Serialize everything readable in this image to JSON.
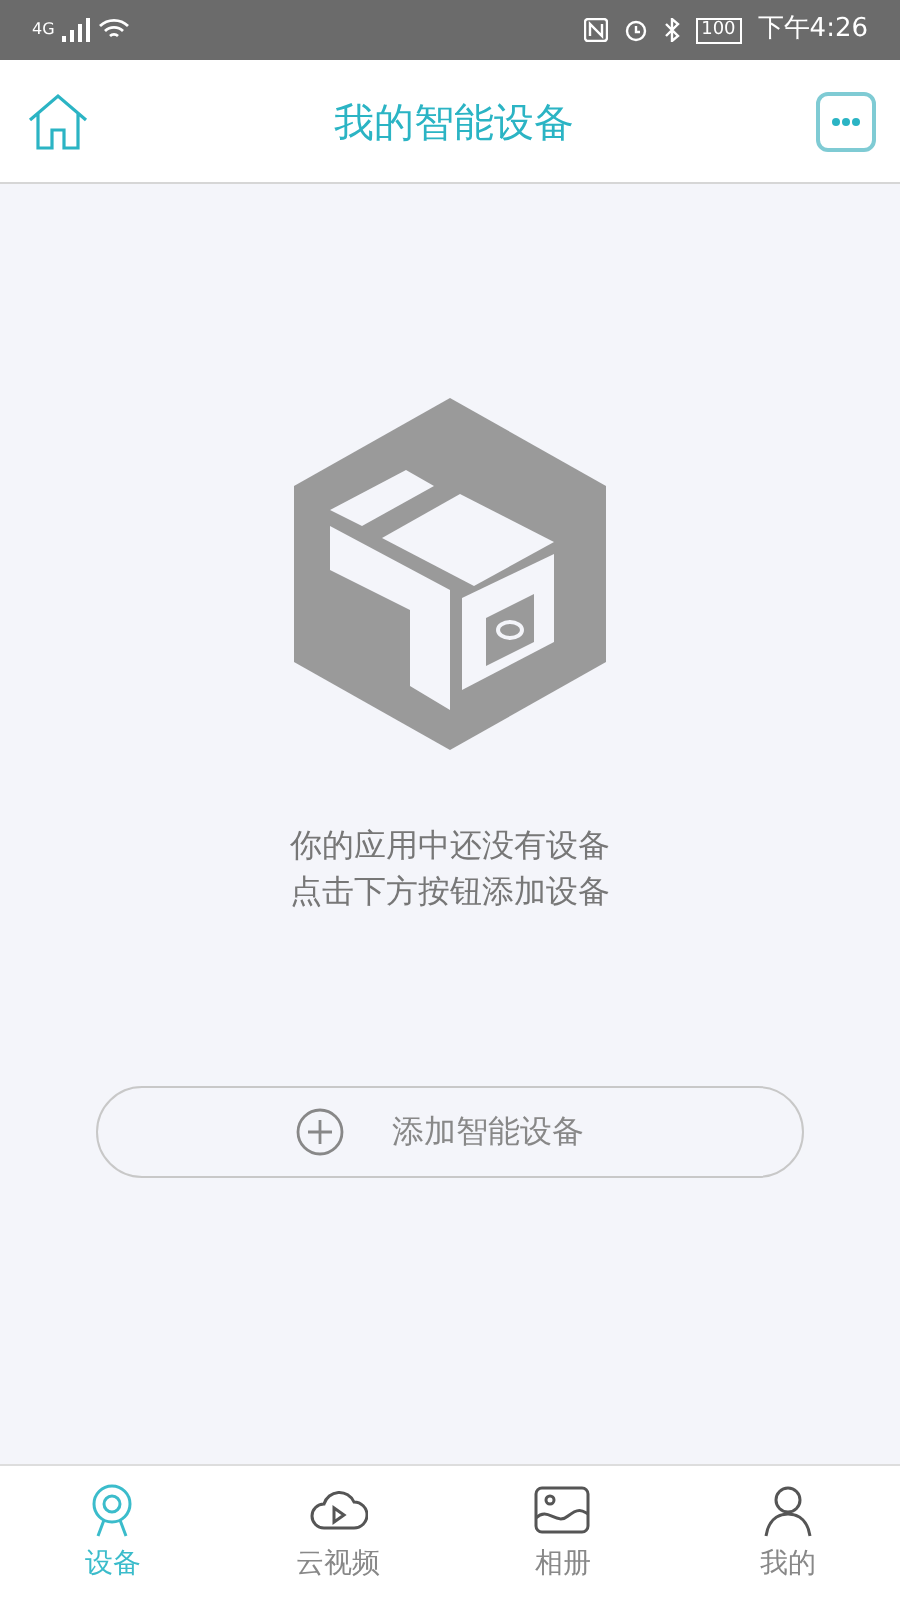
{
  "status_bar": {
    "network": "4G",
    "battery": "100",
    "time": "下午4:26"
  },
  "header": {
    "title": "我的智能设备"
  },
  "empty_state": {
    "lines": [
      "你的应用中还没有设备",
      "点击下方按钮添加设备"
    ]
  },
  "add_button": {
    "label": "添加智能设备"
  },
  "tabs": [
    {
      "kind": "camera",
      "label": "设备",
      "selected": true
    },
    {
      "kind": "cloud",
      "label": "云视频",
      "selected": false
    },
    {
      "kind": "album",
      "label": "相册",
      "selected": false
    },
    {
      "kind": "profile",
      "label": "我的",
      "selected": false
    }
  ]
}
